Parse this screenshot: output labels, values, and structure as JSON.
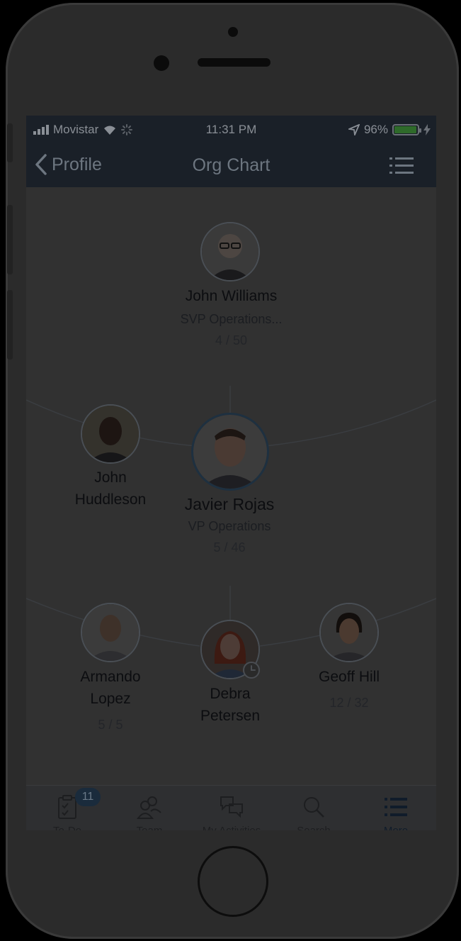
{
  "status": {
    "carrier": "Movistar",
    "time": "11:31 PM",
    "battery_pct": "96%",
    "battery_level": 0.96
  },
  "nav": {
    "back_label": "Profile",
    "title": "Org Chart"
  },
  "org": {
    "manager": {
      "name": "John Williams",
      "role": "SVP Operations...",
      "count": "4 / 50"
    },
    "peer_left": {
      "name_line1": "John",
      "name_line2": "Huddleson"
    },
    "selected": {
      "name": "Javier Rojas",
      "role": "VP Operations",
      "count": "5 / 46"
    },
    "reports": [
      {
        "name_line1": "Armando",
        "name_line2": "Lopez",
        "count": "5 / 5"
      },
      {
        "name_line1": "Debra",
        "name_line2": "Petersen"
      },
      {
        "name_line1": "Geoff Hill",
        "count": "12 / 32"
      }
    ]
  },
  "tabs": [
    {
      "label": "To-Do",
      "badge": "11",
      "icon": "clipboard-check-icon"
    },
    {
      "label": "Team",
      "icon": "team-icon"
    },
    {
      "label": "My Activities",
      "icon": "chat-bubbles-icon"
    },
    {
      "label": "Search",
      "icon": "search-icon"
    },
    {
      "label": "More",
      "icon": "list-icon",
      "active": true
    }
  ],
  "colors": {
    "navbar": "#1a2028",
    "screen": "#313131",
    "accent": "#1a2b3c"
  }
}
